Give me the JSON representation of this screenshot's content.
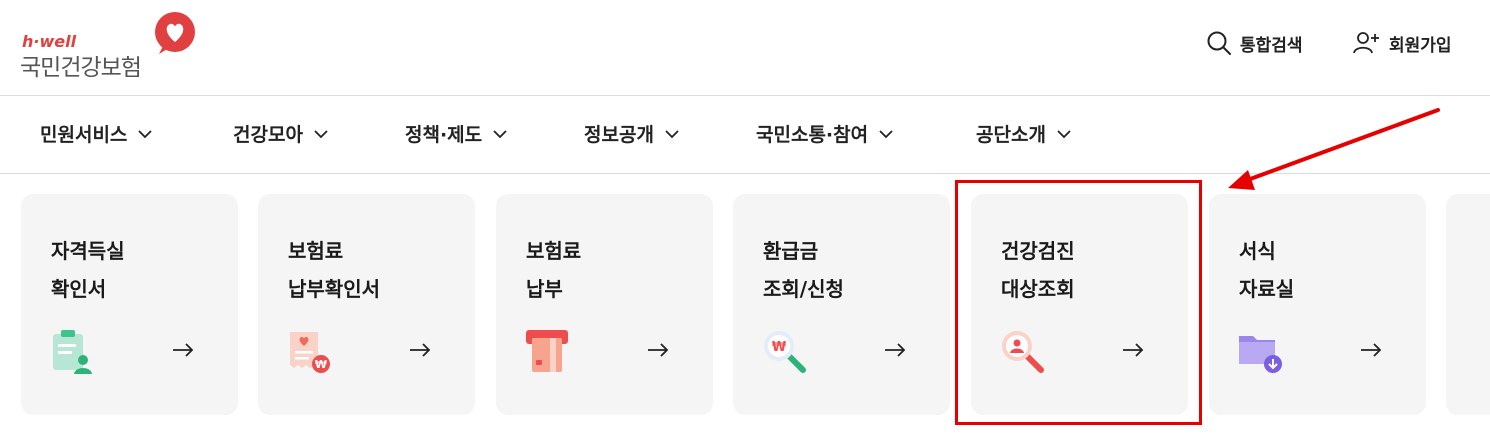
{
  "header": {
    "logo": {
      "sub": "h·well",
      "main": "국민건강보험"
    },
    "utilities": [
      {
        "label": "통합검색",
        "icon": "search-icon"
      },
      {
        "label": "회원가입",
        "icon": "user-plus-icon"
      }
    ]
  },
  "nav": {
    "items": [
      {
        "label": "민원서비스"
      },
      {
        "label": "건강모아"
      },
      {
        "label": "정책·제도"
      },
      {
        "label": "정보공개"
      },
      {
        "label": "국민소통·참여"
      },
      {
        "label": "공단소개"
      }
    ]
  },
  "cards": [
    {
      "line1": "자격득실",
      "line2": "확인서",
      "icon": "certificate-user-icon"
    },
    {
      "line1": "보험료",
      "line2": "납부확인서",
      "icon": "receipt-heart-icon"
    },
    {
      "line1": "보험료",
      "line2": "납부",
      "icon": "card-payment-icon"
    },
    {
      "line1": "환급금",
      "line2": "조회/신청",
      "icon": "refund-search-icon"
    },
    {
      "line1": "건강검진",
      "line2": "대상조회",
      "icon": "person-search-icon"
    },
    {
      "line1": "서식",
      "line2": "자료실",
      "icon": "folder-download-icon"
    },
    {
      "line1": "",
      "line2": "",
      "icon": ""
    }
  ],
  "colors": {
    "accent_red": "#e60000",
    "brand_red": "#e04040",
    "card_bg": "#f5f5f5"
  }
}
